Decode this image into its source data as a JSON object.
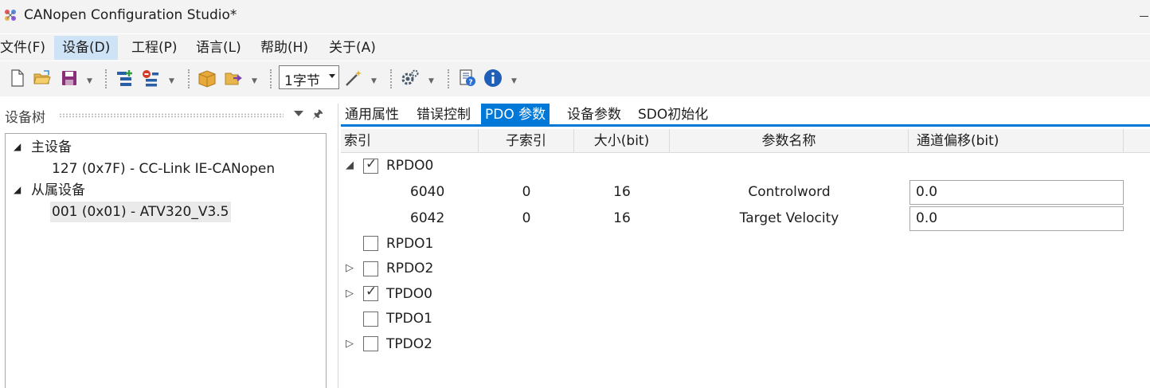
{
  "window": {
    "title": "CANopen Configuration Studio*"
  },
  "menu": [
    {
      "label": "文件(F)"
    },
    {
      "label": "设备(D)"
    },
    {
      "label": "工程(P)"
    },
    {
      "label": "语言(L)"
    },
    {
      "label": "帮助(H)"
    },
    {
      "label": "关于(A)"
    }
  ],
  "toolbar": {
    "size_combo": "1字节",
    "icons": [
      "new-file-icon",
      "open-folder-icon",
      "save-icon",
      "add-device-icon",
      "remove-device-icon",
      "package-icon",
      "export-icon",
      "magic-wand-icon",
      "settings-icon",
      "help-document-icon",
      "info-icon"
    ]
  },
  "left_panel": {
    "title": "设备树",
    "tree": {
      "master_label": "主设备",
      "master_child": "127 (0x7F)  -  CC-Link IE-CANopen",
      "slave_label": "从属设备",
      "slave_child": "001 (0x01)  -  ATV320_V3.5"
    }
  },
  "tabs": [
    {
      "label": "通用属性"
    },
    {
      "label": "错误控制"
    },
    {
      "label": "PDO 参数"
    },
    {
      "label": "设备参数"
    },
    {
      "label": "SDO初始化"
    }
  ],
  "grid": {
    "columns": [
      "索引",
      "子索引",
      "大小(bit)",
      "参数名称",
      "通道偏移(bit)"
    ],
    "groups": [
      {
        "name": "RPDO0",
        "checked": true,
        "expanded": true,
        "rows": [
          {
            "index": "6040",
            "subindex": "0",
            "size": "16",
            "name": "Controlword",
            "offset": "0.0"
          },
          {
            "index": "6042",
            "subindex": "0",
            "size": "16",
            "name": "Target Velocity",
            "offset": "0.0"
          }
        ]
      },
      {
        "name": "RPDO1",
        "checked": false,
        "expanded": null
      },
      {
        "name": "RPDO2",
        "checked": false,
        "expanded": false
      },
      {
        "name": "TPDO0",
        "checked": true,
        "expanded": false
      },
      {
        "name": "TPDO1",
        "checked": false,
        "expanded": null
      },
      {
        "name": "TPDO2",
        "checked": false,
        "expanded": false
      }
    ]
  },
  "colors": {
    "accent": "#0078d7",
    "chrome": "#f3f3f3",
    "menu_active": "#cfe3f6"
  }
}
